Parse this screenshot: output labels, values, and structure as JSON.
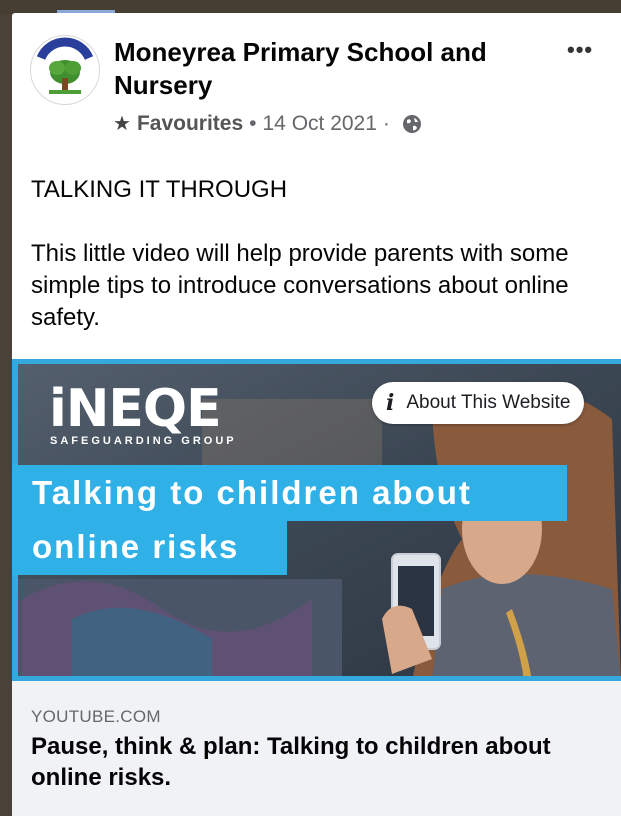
{
  "post": {
    "page_name": "Moneyrea Primary School and Nursery",
    "audience_label": "Favourites",
    "date": "14 Oct 2021",
    "more_icon": "more-horizontal-icon",
    "text_title": "TALKING IT THROUGH",
    "text_body": "This little video will help provide parents with some simple tips to introduce conversations about online safety."
  },
  "link_preview": {
    "logo_text": "iNEQE",
    "logo_subtext": "SAFEGUARDING GROUP",
    "about_button_label": "About This Website",
    "banner_line1": "Talking to children about",
    "banner_line2": "online risks",
    "domain": "YOUTUBE.COM",
    "title": "Pause, think & plan: Talking to children about online risks."
  },
  "colors": {
    "accent_blue": "#2fb0e6",
    "footer_bg": "#f0f2f5"
  }
}
